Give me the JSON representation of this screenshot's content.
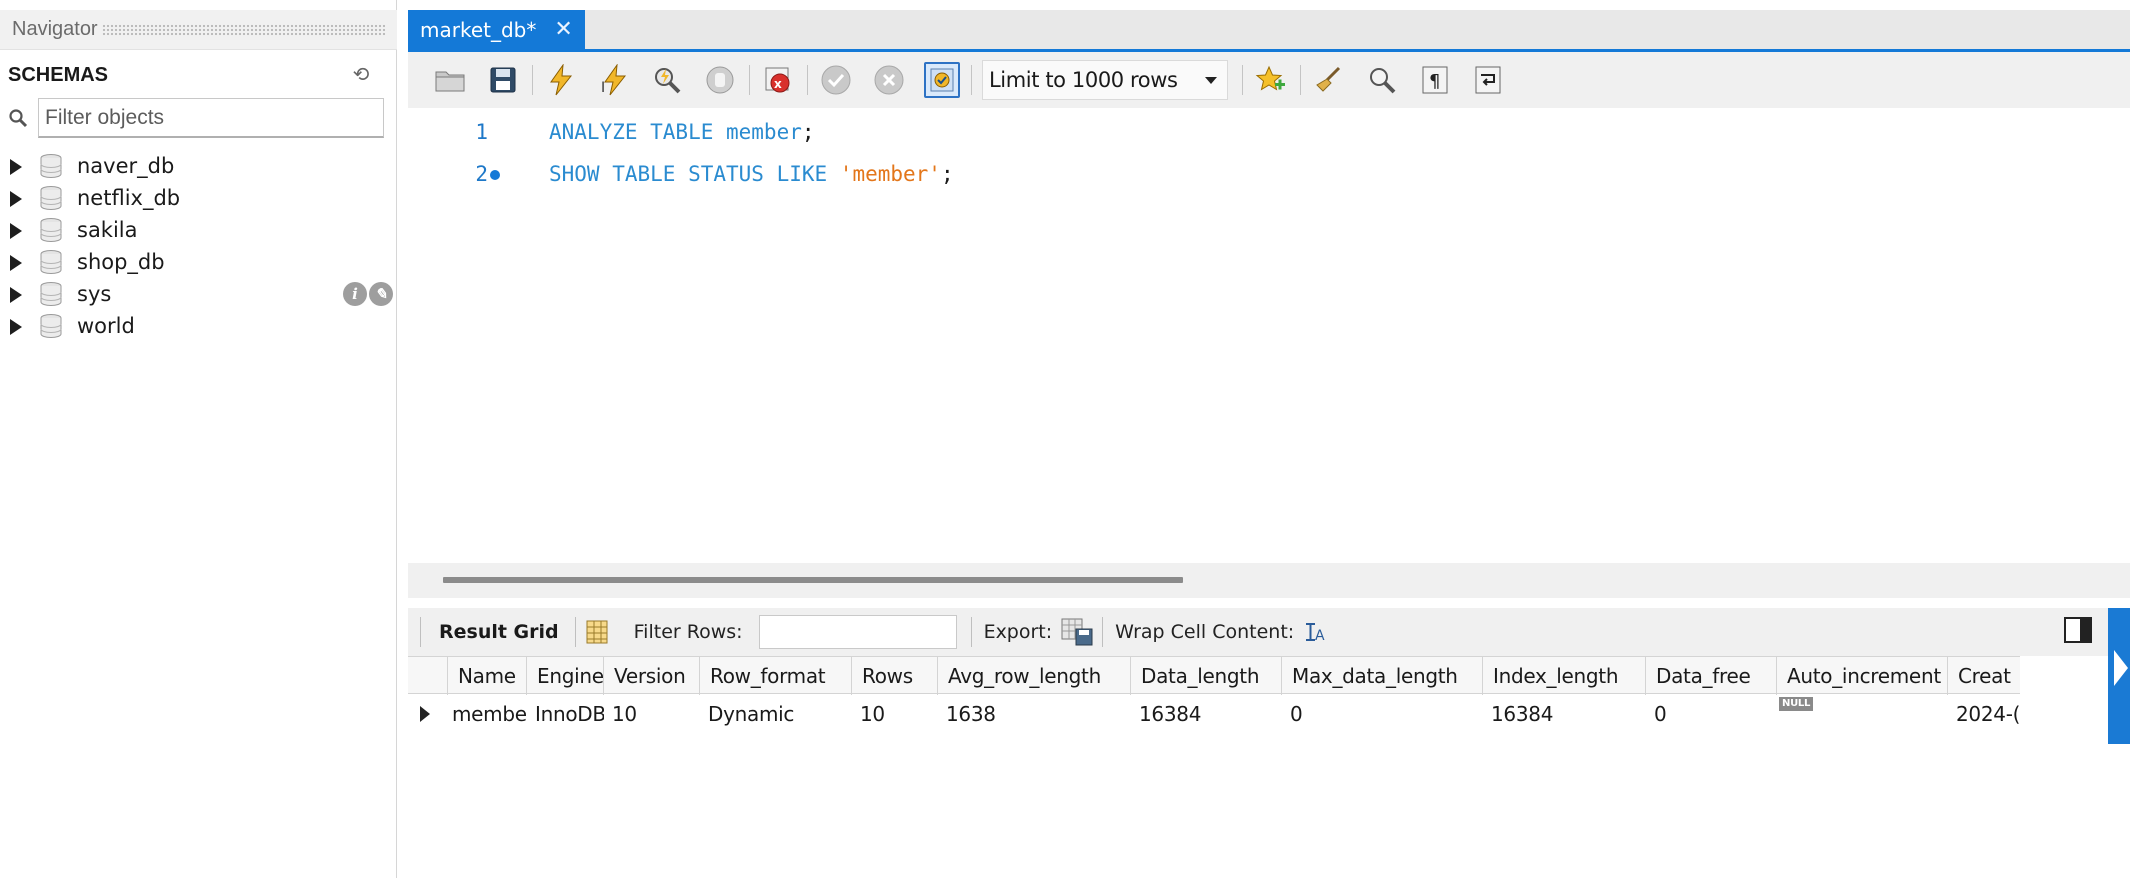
{
  "navigator": {
    "title": "Navigator",
    "schemas_label": "SCHEMAS",
    "filter_placeholder": "Filter objects",
    "schemas": [
      "naver_db",
      "netflix_db",
      "sakila",
      "shop_db",
      "sys",
      "world"
    ]
  },
  "tab": {
    "label": "market_db*"
  },
  "toolbar": {
    "limit_label": "Limit to 1000 rows"
  },
  "editor": {
    "lines": [
      {
        "no": "1",
        "keyword1": "ANALYZE TABLE member",
        "plain1": ";",
        "string": "",
        "plain2": ""
      },
      {
        "no": "2",
        "keyword1": "SHOW TABLE STATUS LIKE ",
        "plain1": "",
        "string": "'member'",
        "plain2": ";"
      }
    ]
  },
  "result_toolbar": {
    "result_grid": "Result Grid",
    "filter_rows": "Filter Rows:",
    "export": "Export:",
    "wrap_cell": "Wrap Cell Content:"
  },
  "grid": {
    "columns": [
      "Name",
      "Engine",
      "Version",
      "Row_format",
      "Rows",
      "Avg_row_length",
      "Data_length",
      "Max_data_length",
      "Index_length",
      "Data_free",
      "Auto_increment",
      "Creat"
    ],
    "row": [
      "member",
      "InnoDB",
      "10",
      "Dynamic",
      "10",
      "1638",
      "16384",
      "0",
      "16384",
      "0",
      "NULL",
      "2024-("
    ]
  },
  "colors": {
    "accent": "#1479d7",
    "keyword": "#2a8bd0",
    "string": "#e3761a"
  }
}
